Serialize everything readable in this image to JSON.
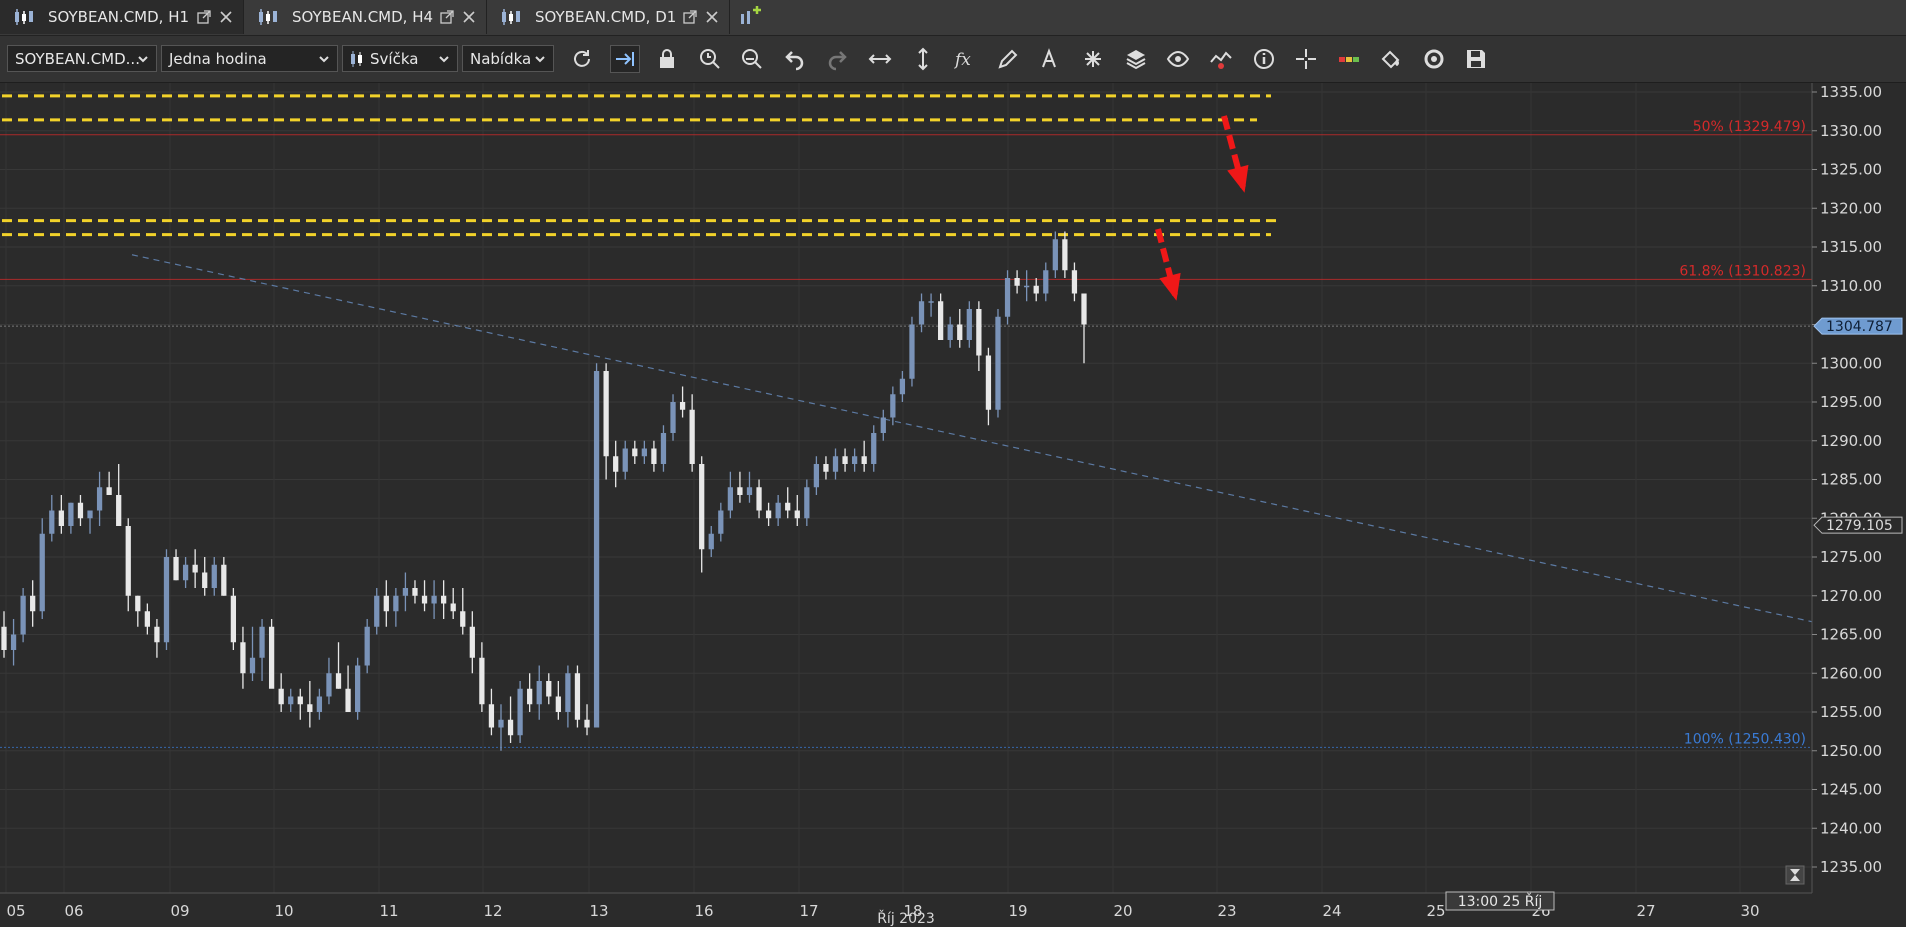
{
  "tabs": [
    {
      "label": "SOYBEAN.CMD, H1",
      "active": true
    },
    {
      "label": "SOYBEAN.CMD, H4",
      "active": false
    },
    {
      "label": "SOYBEAN.CMD, D1",
      "active": false
    }
  ],
  "toolbar": {
    "instrument": "SOYBEAN.CMD...",
    "period": "Jedna hodina",
    "chart_type": "Svíčka",
    "price_side": "Nabídka",
    "tools": [
      "refresh-icon",
      "auto-shift-icon",
      "lock-icon",
      "zoom-time-icon",
      "zoom-fit-icon",
      "undo-icon",
      "redo-icon",
      "horizontal-scale-icon",
      "vertical-scale-icon",
      "indicators-fx-icon",
      "pencil-icon",
      "text-tool-icon",
      "pattern-tool-icon",
      "layers-icon",
      "eye-icon",
      "chart-overlay-icon",
      "info-icon",
      "crosshair-icon",
      "trade-level-icon",
      "theme-bucket-icon",
      "reset-icon",
      "save-icon"
    ]
  },
  "chart_data": {
    "type": "candlestick",
    "instrument": "SOYBEAN.CMD",
    "timeframe": "H1",
    "y_range": [
      1230,
      1338
    ],
    "y_ticks": [
      "1335.00",
      "1330.00",
      "1325.00",
      "1320.00",
      "1315.00",
      "1310.00",
      "1305.00",
      "1300.00",
      "1295.00",
      "1290.00",
      "1285.00",
      "1280.00",
      "1275.00",
      "1270.00",
      "1265.00",
      "1260.00",
      "1255.00",
      "1250.00",
      "1245.00",
      "1240.00",
      "1235.00"
    ],
    "x_ticks": [
      "05",
      "06",
      "09",
      "10",
      "11",
      "12",
      "13",
      "16",
      "17",
      "18",
      "19",
      "20",
      "23",
      "24",
      "25",
      "26",
      "27",
      "30"
    ],
    "x_axis_month": "Říj 2023",
    "crosshair_time": "13:00 25 Říj",
    "current_price": "1304.787",
    "marker_price": "1279.105",
    "fibonacci": [
      {
        "label": "50% (1329.479)",
        "value": 1329.479,
        "color": "#d42a2a"
      },
      {
        "label": "61.8% (1310.823)",
        "value": 1310.823,
        "color": "#d42a2a"
      },
      {
        "label": "100% (1250.430)",
        "value": 1250.43,
        "color": "#3a7bd5"
      }
    ],
    "resistance_lines": [
      1334.5,
      1331.4,
      1318.4,
      1316.6
    ],
    "trendline": {
      "from": [
        1314,
        132
      ],
      "to": [
        1264,
        1906
      ]
    },
    "candle_colors": {
      "up": "#7a93b8",
      "down": "#e8e8e8"
    },
    "candles": [
      [
        1266,
        1268,
        1262,
        1263
      ],
      [
        1263,
        1267,
        1261,
        1265
      ],
      [
        1265,
        1271,
        1264,
        1270
      ],
      [
        1270,
        1272,
        1266,
        1268
      ],
      [
        1268,
        1280,
        1267,
        1278
      ],
      [
        1278,
        1283,
        1277,
        1281
      ],
      [
        1281,
        1283,
        1278,
        1279
      ],
      [
        1279,
        1282,
        1278,
        1282
      ],
      [
        1282,
        1283,
        1279,
        1280
      ],
      [
        1280,
        1281,
        1278,
        1281
      ],
      [
        1281,
        1286,
        1279,
        1284
      ],
      [
        1284,
        1286,
        1283,
        1283
      ],
      [
        1283,
        1287,
        1282,
        1279
      ],
      [
        1279,
        1280,
        1268,
        1270
      ],
      [
        1270,
        1270,
        1266,
        1268
      ],
      [
        1268,
        1269,
        1265,
        1266
      ],
      [
        1266,
        1267,
        1262,
        1264
      ],
      [
        1264,
        1276,
        1263,
        1275
      ],
      [
        1275,
        1276,
        1272,
        1272
      ],
      [
        1272,
        1275,
        1271,
        1274
      ],
      [
        1274,
        1276,
        1271,
        1273
      ],
      [
        1273,
        1275,
        1270,
        1271
      ],
      [
        1271,
        1275,
        1270,
        1274
      ],
      [
        1274,
        1275,
        1270,
        1270
      ],
      [
        1270,
        1271,
        1263,
        1264
      ],
      [
        1264,
        1266,
        1258,
        1260
      ],
      [
        1260,
        1266,
        1259,
        1262
      ],
      [
        1262,
        1267,
        1259,
        1266
      ],
      [
        1266,
        1267,
        1259,
        1258
      ],
      [
        1258,
        1260,
        1255,
        1256
      ],
      [
        1256,
        1258,
        1255,
        1257
      ],
      [
        1257,
        1258,
        1254,
        1256
      ],
      [
        1256,
        1259,
        1253,
        1255
      ],
      [
        1255,
        1258,
        1254,
        1257
      ],
      [
        1257,
        1262,
        1256,
        1260
      ],
      [
        1260,
        1264,
        1258,
        1258
      ],
      [
        1258,
        1261,
        1255,
        1255
      ],
      [
        1255,
        1262,
        1254,
        1261
      ],
      [
        1261,
        1267,
        1260,
        1266
      ],
      [
        1266,
        1271,
        1265,
        1270
      ],
      [
        1270,
        1272,
        1266,
        1268
      ],
      [
        1268,
        1271,
        1266,
        1270
      ],
      [
        1270,
        1273,
        1268,
        1271
      ],
      [
        1271,
        1272,
        1269,
        1270
      ],
      [
        1270,
        1272,
        1268,
        1269
      ],
      [
        1269,
        1272,
        1267,
        1270
      ],
      [
        1270,
        1272,
        1267,
        1269
      ],
      [
        1269,
        1271,
        1267,
        1268
      ],
      [
        1268,
        1271,
        1265,
        1266
      ],
      [
        1266,
        1268,
        1260,
        1262
      ],
      [
        1262,
        1264,
        1255,
        1256
      ],
      [
        1256,
        1258,
        1252,
        1253
      ],
      [
        1253,
        1256,
        1250,
        1254
      ],
      [
        1254,
        1257,
        1251,
        1252
      ],
      [
        1252,
        1259,
        1251,
        1258
      ],
      [
        1258,
        1260,
        1255,
        1256
      ],
      [
        1256,
        1261,
        1254,
        1259
      ],
      [
        1259,
        1260,
        1256,
        1257
      ],
      [
        1257,
        1259,
        1254,
        1255
      ],
      [
        1255,
        1261,
        1253,
        1260
      ],
      [
        1260,
        1261,
        1253,
        1254
      ],
      [
        1254,
        1256,
        1252,
        1253
      ],
      [
        1253,
        1300,
        1253,
        1299
      ],
      [
        1299,
        1300,
        1285,
        1288
      ],
      [
        1288,
        1290,
        1284,
        1286
      ],
      [
        1286,
        1290,
        1285,
        1289
      ],
      [
        1289,
        1290,
        1287,
        1288
      ],
      [
        1288,
        1290,
        1287,
        1289
      ],
      [
        1289,
        1290,
        1286,
        1287
      ],
      [
        1287,
        1292,
        1286,
        1291
      ],
      [
        1291,
        1296,
        1290,
        1295
      ],
      [
        1295,
        1297,
        1293,
        1294
      ],
      [
        1294,
        1296,
        1286,
        1287
      ],
      [
        1287,
        1288,
        1273,
        1276
      ],
      [
        1276,
        1279,
        1275,
        1278
      ],
      [
        1278,
        1282,
        1277,
        1281
      ],
      [
        1281,
        1286,
        1280,
        1284
      ],
      [
        1284,
        1286,
        1282,
        1283
      ],
      [
        1283,
        1286,
        1282,
        1284
      ],
      [
        1284,
        1285,
        1280,
        1281
      ],
      [
        1281,
        1282,
        1279,
        1280
      ],
      [
        1280,
        1283,
        1279,
        1282
      ],
      [
        1282,
        1284,
        1280,
        1281
      ],
      [
        1281,
        1283,
        1279,
        1280
      ],
      [
        1280,
        1285,
        1279,
        1284
      ],
      [
        1284,
        1288,
        1283,
        1287
      ],
      [
        1287,
        1288,
        1285,
        1286
      ],
      [
        1286,
        1289,
        1285,
        1288
      ],
      [
        1288,
        1289,
        1286,
        1287
      ],
      [
        1287,
        1289,
        1286,
        1288
      ],
      [
        1288,
        1290,
        1286,
        1287
      ],
      [
        1287,
        1292,
        1286,
        1291
      ],
      [
        1291,
        1294,
        1290,
        1293
      ],
      [
        1293,
        1297,
        1292,
        1296
      ],
      [
        1296,
        1299,
        1295,
        1298
      ],
      [
        1298,
        1306,
        1297,
        1305
      ],
      [
        1305,
        1309,
        1304,
        1308
      ],
      [
        1308,
        1309,
        1306,
        1308
      ],
      [
        1308,
        1309,
        1304,
        1303
      ],
      [
        1303,
        1306,
        1302,
        1305
      ],
      [
        1305,
        1307,
        1302,
        1303
      ],
      [
        1303,
        1308,
        1302,
        1307
      ],
      [
        1307,
        1308,
        1299,
        1301
      ],
      [
        1301,
        1302,
        1292,
        1294
      ],
      [
        1294,
        1307,
        1293,
        1306
      ],
      [
        1306,
        1312,
        1305,
        1311
      ],
      [
        1311,
        1312,
        1309,
        1310
      ],
      [
        1310,
        1312,
        1308,
        1310
      ],
      [
        1310,
        1311,
        1308,
        1309
      ],
      [
        1309,
        1313,
        1308,
        1312
      ],
      [
        1312,
        1317,
        1311,
        1316
      ],
      [
        1316,
        1317,
        1311,
        1312
      ],
      [
        1312,
        1313,
        1308,
        1309
      ],
      [
        1309,
        1309,
        1300,
        1305
      ]
    ]
  }
}
